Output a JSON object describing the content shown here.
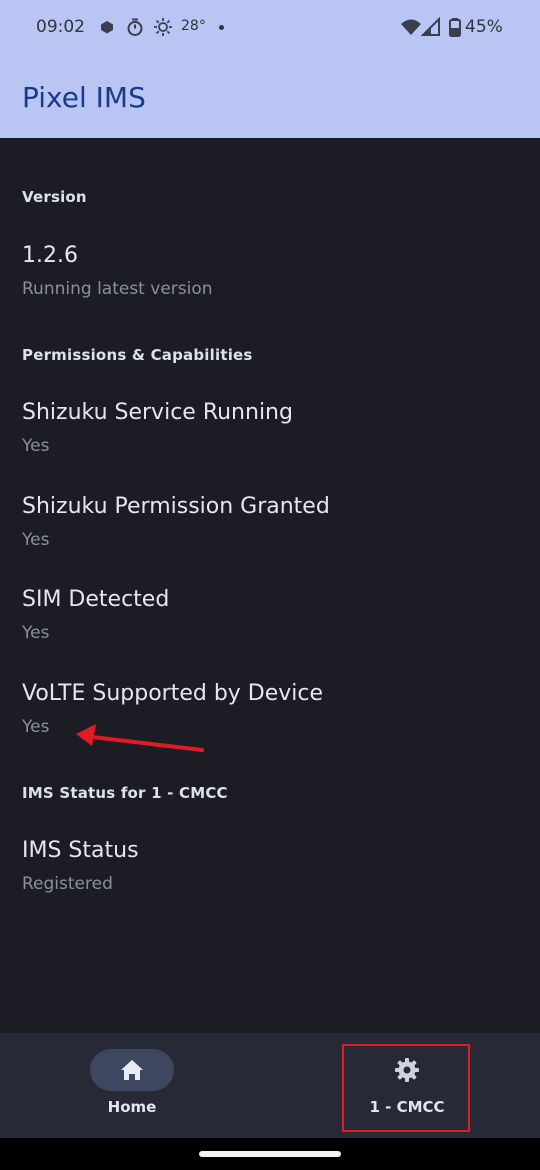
{
  "status_bar": {
    "time": "09:02",
    "temperature": "28°",
    "battery": "45%",
    "icons": [
      "app-notification-icon",
      "timer-icon",
      "brightness-icon",
      "wifi-icon",
      "cellular-signal-icon",
      "battery-icon"
    ]
  },
  "app_bar": {
    "title": "Pixel IMS"
  },
  "sections": {
    "version": {
      "header": "Version",
      "title": "1.2.6",
      "subtitle": "Running latest version"
    },
    "permissions": {
      "header": "Permissions & Capabilities",
      "items": [
        {
          "title": "Shizuku Service Running",
          "value": "Yes"
        },
        {
          "title": "Shizuku Permission Granted",
          "value": "Yes"
        },
        {
          "title": "SIM Detected",
          "value": "Yes"
        },
        {
          "title": "VoLTE Supported by Device",
          "value": "Yes"
        }
      ]
    },
    "ims": {
      "header": "IMS Status for 1 - CMCC",
      "title": "IMS Status",
      "subtitle": "Registered"
    }
  },
  "bottom_nav": {
    "home_label": "Home",
    "sim_label": "1 - CMCC"
  },
  "colors": {
    "app_bar_bg": "#b9c6f3",
    "background": "#1b1c24",
    "annotation": "#e01b24"
  }
}
